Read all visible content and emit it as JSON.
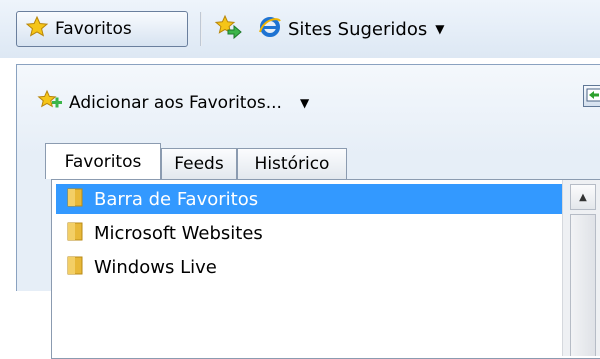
{
  "favorites_bar": {
    "favorites_button_label": "Favoritos",
    "suggested_sites_label": "Sites Sugeridos",
    "icons": [
      "star-icon",
      "add-to-bar-icon",
      "ie-icon",
      "chevron-down-icon"
    ]
  },
  "panel": {
    "add_to_favorites_label": "Adicionar aos Favoritos...",
    "tabs": [
      {
        "label": "Favoritos",
        "active": true
      },
      {
        "label": "Feeds",
        "active": false
      },
      {
        "label": "Histórico",
        "active": false
      }
    ],
    "items": [
      {
        "label": "Barra de Favoritos",
        "selected": true
      },
      {
        "label": "Microsoft Websites",
        "selected": false
      },
      {
        "label": "Windows Live",
        "selected": false
      }
    ]
  },
  "colors": {
    "selection": "#3399ff",
    "folder": "#e8b838",
    "star": "#f2c230"
  }
}
